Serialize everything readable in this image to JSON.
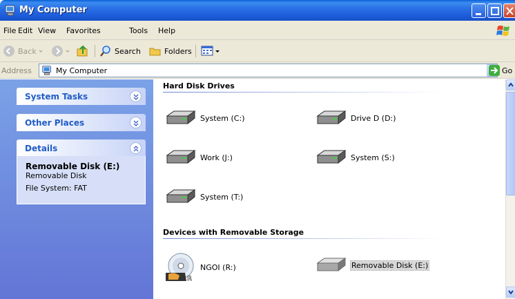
{
  "window": {
    "title": "My Computer",
    "icons": {
      "app": "my-computer-icon",
      "minimize": "minimize-icon",
      "maximize": "maximize-icon",
      "close": "close-icon"
    }
  },
  "menu": {
    "items": [
      {
        "label": "File",
        "key": "F"
      },
      {
        "label": "Edit",
        "key": "E"
      },
      {
        "label": "View",
        "key": "V"
      },
      {
        "label": "Favorites",
        "key": "a"
      },
      {
        "label": "Tools",
        "key": "T"
      },
      {
        "label": "Help",
        "key": "H"
      }
    ]
  },
  "toolbar": {
    "back_label": "Back",
    "search_label": "Search",
    "folders_label": "Folders"
  },
  "address": {
    "label": "Address",
    "value": "My Computer",
    "go_label": "Go"
  },
  "taskpane": {
    "system_tasks": "System Tasks",
    "other_places": "Other Places",
    "details": {
      "title": "Details",
      "item_name": "Removable Disk (E:)",
      "item_type": "Removable Disk",
      "file_system": "File System: FAT"
    }
  },
  "content": {
    "hard_disks_header": "Hard Disk Drives",
    "hard_disks": [
      {
        "label": "System (C:)",
        "icon": "hard-drive-icon"
      },
      {
        "label": "Drive D (D:)",
        "icon": "hard-drive-icon"
      },
      {
        "label": "Work (J:)",
        "icon": "hard-drive-icon"
      },
      {
        "label": "System (S:)",
        "icon": "hard-drive-icon"
      },
      {
        "label": "System (T:)",
        "icon": "hard-drive-icon"
      }
    ],
    "removable_header": "Devices with Removable Storage",
    "removable": [
      {
        "label": "NGOI (R:)",
        "icon": "cd-drive-icon"
      },
      {
        "label": "Removable Disk (E:)",
        "icon": "removable-disk-icon",
        "selected": true
      }
    ]
  },
  "colors": {
    "titlebar": "#2b71e6",
    "taskpane_gradient_top": "#7ba2e7",
    "taskpane_gradient_bottom": "#6375d6",
    "group_title": "#215dc6",
    "chrome": "#ece9d8"
  }
}
